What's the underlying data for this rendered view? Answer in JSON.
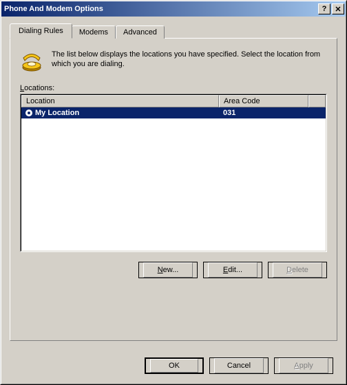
{
  "window": {
    "title": "Phone And Modem Options"
  },
  "tabs": {
    "dialing_rules": "Dialing Rules",
    "modems": "Modems",
    "advanced": "Advanced"
  },
  "intro_text": "The list below displays the locations you have specified. Select the location from which you are dialing.",
  "locations_label_prefix": "L",
  "locations_label_rest": "ocations:",
  "listview": {
    "headers": {
      "location": "Location",
      "area_code": "Area Code"
    },
    "rows": [
      {
        "location": "My Location",
        "area_code": "031",
        "selected": true
      }
    ]
  },
  "buttons": {
    "new_prefix": "N",
    "new_rest": "ew...",
    "edit_prefix": "E",
    "edit_rest": "dit...",
    "delete_prefix": "D",
    "delete_rest": "elete",
    "ok": "OK",
    "cancel": "Cancel",
    "apply_prefix": "A",
    "apply_rest": "pply"
  }
}
